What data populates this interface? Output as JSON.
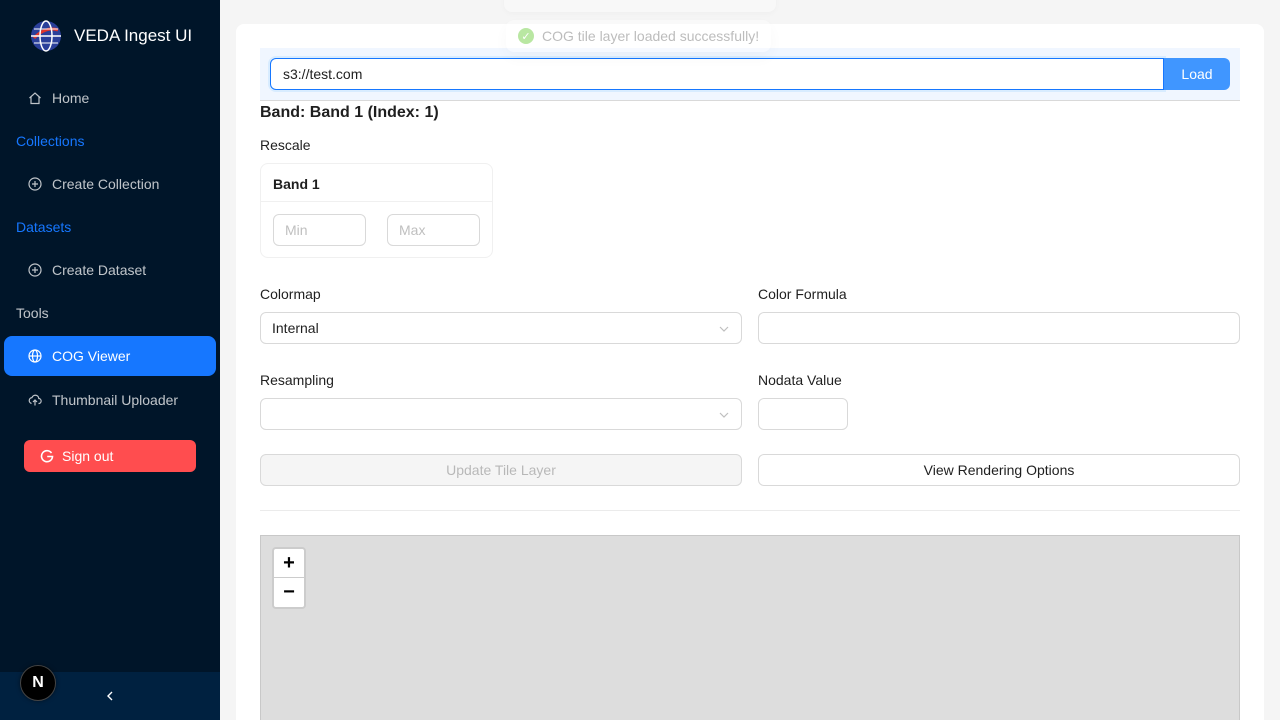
{
  "app": {
    "title": "VEDA Ingest UI"
  },
  "sidebar": {
    "home": "Home",
    "collections_group": "Collections",
    "create_collection": "Create Collection",
    "datasets_group": "Datasets",
    "create_dataset": "Create Dataset",
    "tools_group": "Tools",
    "cog_viewer": "COG Viewer",
    "thumbnail_uploader": "Thumbnail Uploader",
    "sign_out": "Sign out",
    "collapse_icon": "chevron-left-icon",
    "active_color": "#1677ff",
    "badge": "N"
  },
  "toast": {
    "message": "COG tile layer loaded successfully!",
    "status_color": "#52c41a"
  },
  "url_bar": {
    "value": "s3://test.com",
    "load_label": "Load"
  },
  "band": {
    "title": "Band: Band 1 (Index: 1)",
    "rescale_label": "Rescale",
    "card_title": "Band 1",
    "min_placeholder": "Min",
    "max_placeholder": "Max"
  },
  "form": {
    "colormap_label": "Colormap",
    "colormap_value": "Internal",
    "color_formula_label": "Color Formula",
    "color_formula_value": "",
    "resampling_label": "Resampling",
    "resampling_value": "",
    "nodata_label": "Nodata Value",
    "nodata_value": "",
    "update_button": "Update Tile Layer",
    "view_button": "View Rendering Options"
  },
  "map": {
    "zoom_in": "+",
    "zoom_out": "−"
  }
}
